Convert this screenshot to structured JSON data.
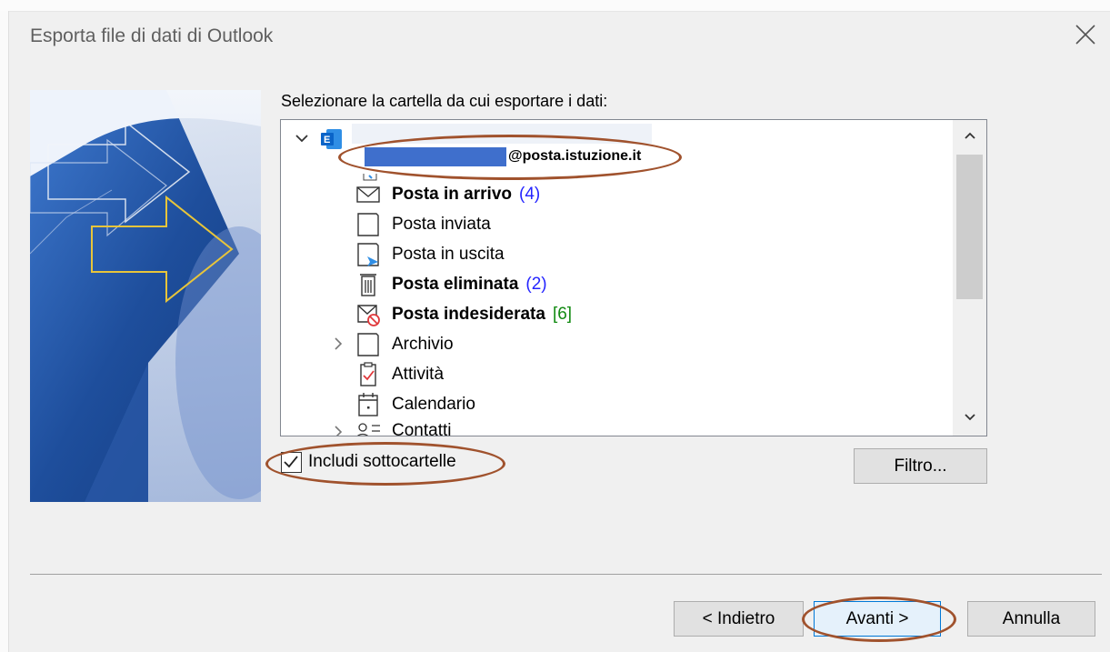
{
  "dialog": {
    "title": "Esporta file di dati di Outlook"
  },
  "tree": {
    "prompt": "Selezionare la cartella da cui esportare i dati:",
    "account_email_suffix": "@posta.istuzione.it",
    "items": [
      {
        "label": "Posta in arrivo",
        "count": "(4)",
        "icon": "inbox-icon",
        "bold": true
      },
      {
        "label": "Posta inviata",
        "count": "",
        "icon": "folder-icon",
        "bold": false
      },
      {
        "label": "Posta in uscita",
        "count": "",
        "icon": "outbox-icon",
        "bold": false
      },
      {
        "label": "Posta eliminata",
        "count": "(2)",
        "icon": "trash-icon",
        "bold": true
      },
      {
        "label": "Posta indesiderata",
        "count": "[6]",
        "icon": "junk-icon",
        "bold": true
      },
      {
        "label": "Archivio",
        "count": "",
        "icon": "folder-icon",
        "bold": false
      },
      {
        "label": "Attività",
        "count": "",
        "icon": "tasks-icon",
        "bold": false
      },
      {
        "label": "Calendario",
        "count": "",
        "icon": "calendar-icon",
        "bold": false
      },
      {
        "label": "Contatti",
        "count": "",
        "icon": "contacts-icon",
        "bold": false
      }
    ]
  },
  "options": {
    "include_subfolders_label": "Includi sottocartelle",
    "include_subfolders_checked": true,
    "filter_button": "Filtro..."
  },
  "footer": {
    "back_button": "< Indietro",
    "next_button": "Avanti >",
    "cancel_button": "Annulla"
  },
  "colors": {
    "annotation_oval": "#a0522d",
    "redaction_bar": "#3f6fcc",
    "outlook_blue": "#0a64c8"
  }
}
